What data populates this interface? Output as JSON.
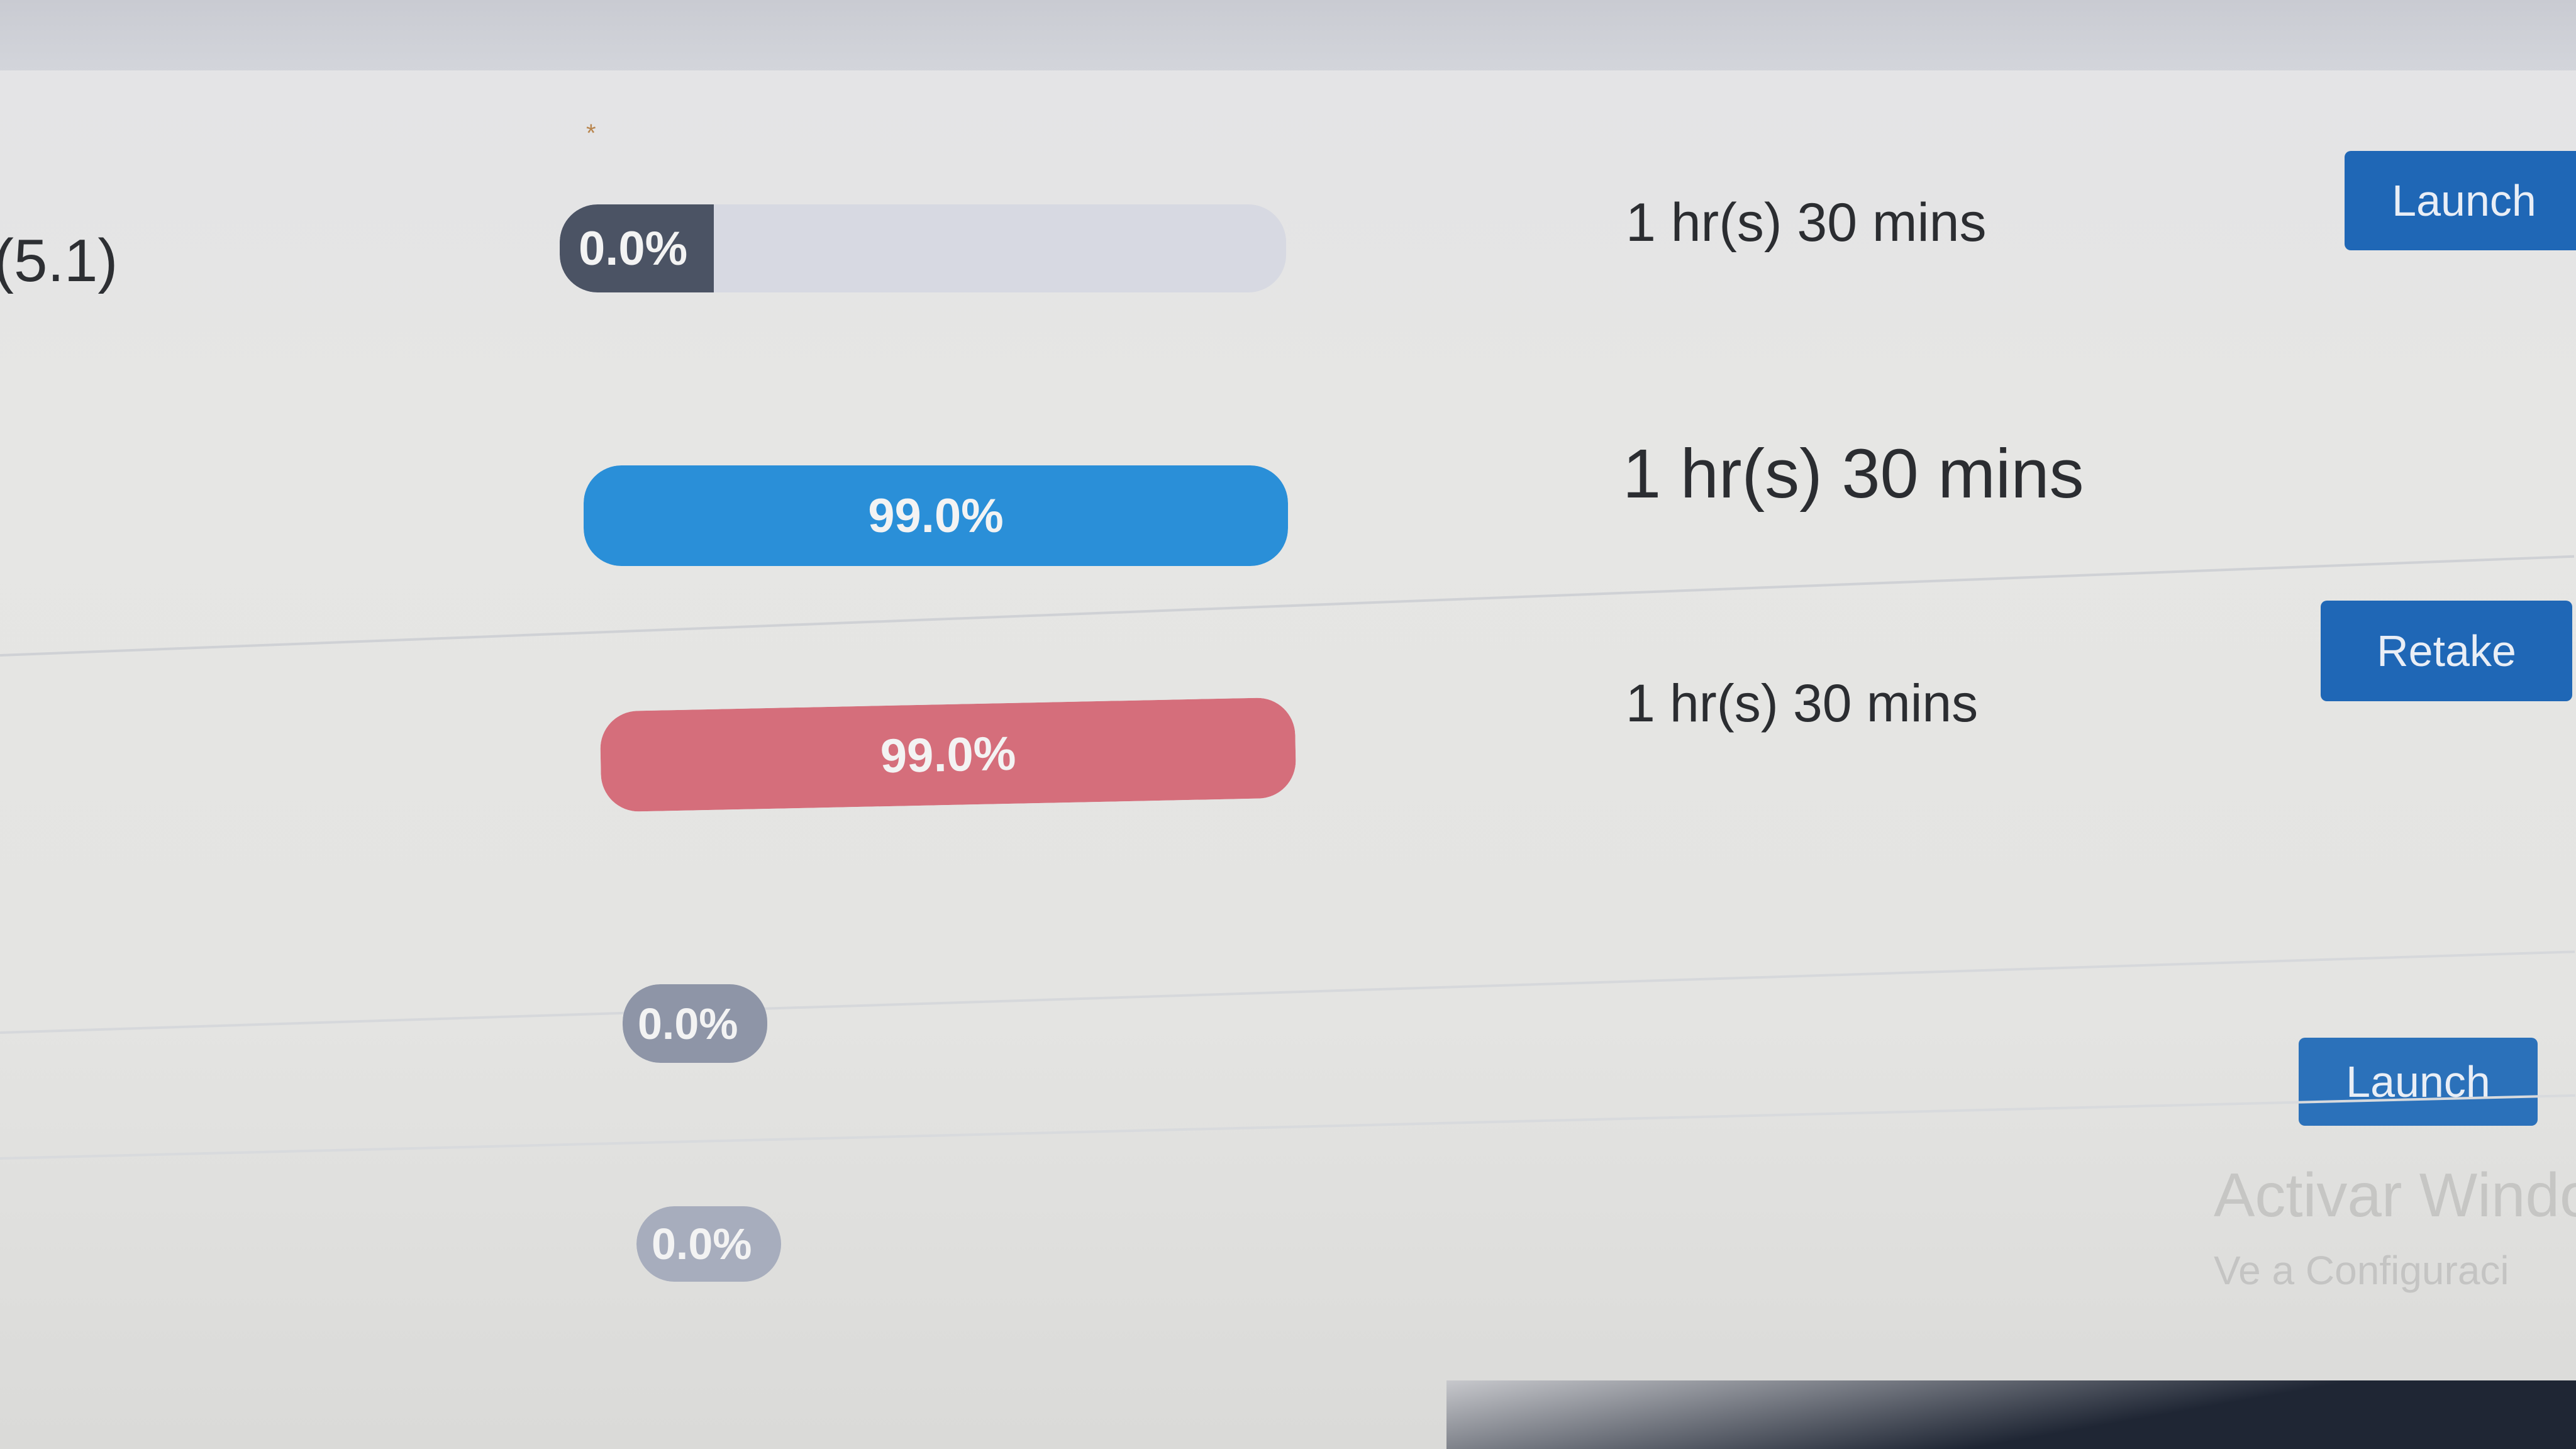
{
  "rows": [
    {
      "label": "(5.1)",
      "progress": {
        "percent": 0.0,
        "text": "0.0%",
        "style": "dark"
      },
      "duration": "1 hr(s) 30 mins",
      "button": "Launch"
    },
    {
      "label": "",
      "progress": {
        "percent": 99.0,
        "text": "99.0%",
        "style": "blue"
      },
      "duration": "1 hr(s) 30 mins",
      "button": ""
    },
    {
      "label": "",
      "progress": {
        "percent": 99.0,
        "text": "99.0%",
        "style": "red"
      },
      "duration": "1 hr(s) 30 mins",
      "button": "Retake"
    },
    {
      "label": "",
      "progress": {
        "percent": 0.0,
        "text": "0.0%",
        "style": "grey"
      },
      "duration": "",
      "button": "Launch"
    },
    {
      "label": "",
      "progress": {
        "percent": 0.0,
        "text": "0.0%",
        "style": "grey"
      },
      "duration": "",
      "button": ""
    }
  ],
  "colors": {
    "button_blue": "#1f67b6",
    "progress_blue": "#2a8fd8",
    "progress_red": "#d56e7b",
    "progress_dark": "#4b5364",
    "progress_grey": "#8e95a7",
    "track": "#d7d9e2"
  },
  "watermark": {
    "line1": "Activar Windo",
    "line2": "Ve a Configuraci"
  }
}
